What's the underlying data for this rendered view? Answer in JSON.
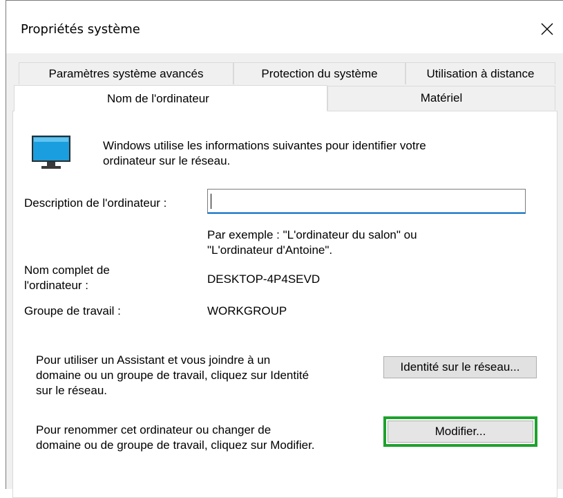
{
  "window": {
    "title": "Propriétés système",
    "close_icon": "close-icon"
  },
  "tabs": {
    "row1": [
      {
        "label": "Paramètres système avancés"
      },
      {
        "label": "Protection du système"
      },
      {
        "label": "Utilisation à distance"
      }
    ],
    "row2": [
      {
        "label": "Nom de l'ordinateur",
        "active": true
      },
      {
        "label": "Matériel",
        "active": false
      }
    ]
  },
  "content": {
    "icon": "monitor-icon",
    "intro_line1": "Windows utilise les informations suivantes pour identifier votre",
    "intro_line2": "ordinateur sur le réseau.",
    "description_label": "Description de l'ordinateur :",
    "description_value": "",
    "example_line1": "Par exemple : \"L'ordinateur du salon\" ou",
    "example_line2": "\"L'ordinateur d'Antoine\".",
    "full_name_label_line1": "Nom complet de",
    "full_name_label_line2": "l'ordinateur :",
    "full_name_value": "DESKTOP-4P4SEVD",
    "workgroup_label": "Groupe de travail :",
    "workgroup_value": "WORKGROUP",
    "join_text_line1": "Pour utiliser un Assistant et vous joindre à un",
    "join_text_line2": "domaine ou un groupe de travail, cliquez sur Identité",
    "join_text_line3": "sur le réseau.",
    "network_id_button": "Identité sur le réseau...",
    "rename_text_line1": "Pour renommer cet ordinateur ou changer de",
    "rename_text_line2": "domaine ou de groupe de travail, cliquez sur Modifier.",
    "modify_button": "Modifier...",
    "highlight_color": "#1ea12d"
  }
}
